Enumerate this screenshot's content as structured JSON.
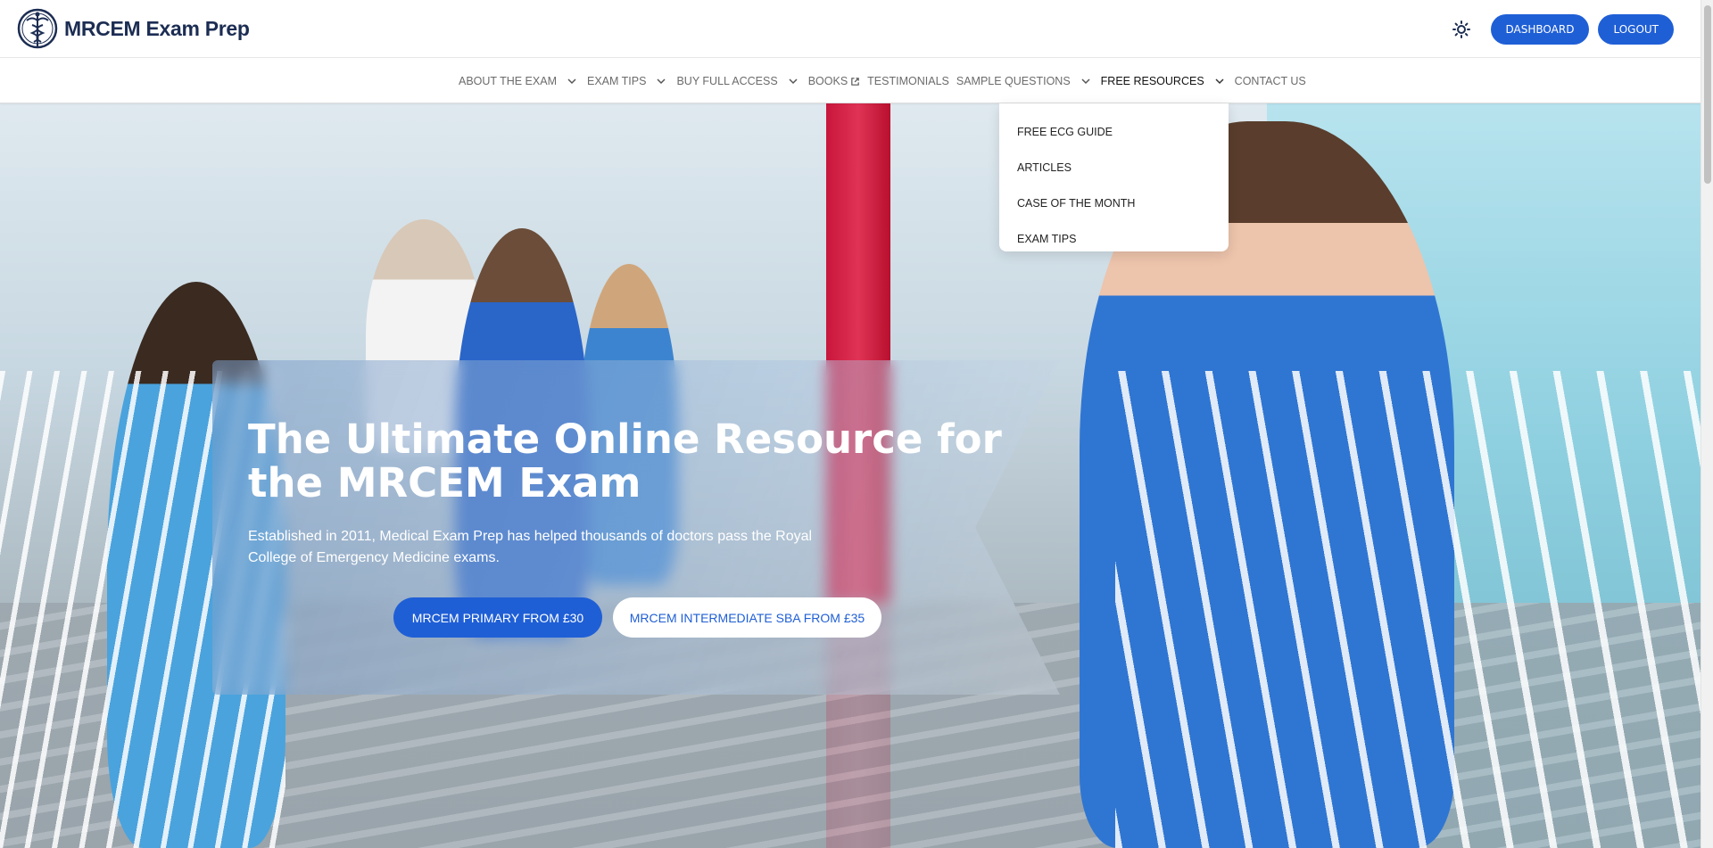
{
  "header": {
    "logo_text": "MRCEM Exam Prep",
    "theme_toggle_icon": "sun-icon",
    "dashboard_label": "DASHBOARD",
    "logout_label": "LOGOUT"
  },
  "nav": {
    "items": [
      {
        "label": "ABOUT THE EXAM",
        "icon": "chevron-down-icon"
      },
      {
        "label": "EXAM TIPS",
        "icon": "chevron-down-icon"
      },
      {
        "label": "BUY FULL ACCESS",
        "icon": "chevron-down-icon"
      },
      {
        "label": "BOOKS",
        "icon": "external-link-icon"
      },
      {
        "label": "TESTIMONIALS"
      },
      {
        "label": "SAMPLE QUESTIONS",
        "icon": "chevron-down-icon"
      },
      {
        "label": "FREE RESOURCES",
        "icon": "chevron-down-icon",
        "active": true
      },
      {
        "label": "CONTACT US"
      }
    ]
  },
  "dropdown": {
    "items": [
      "FREE ECG GUIDE",
      "ARTICLES",
      "CASE OF THE MONTH",
      "EXAM TIPS"
    ]
  },
  "hero": {
    "title": "The Ultimate Online Resource for the MRCEM Exam",
    "subtitle": "Established in 2011, Medical Exam Prep has helped thousands of doctors pass the Royal College of Emergency Medicine exams.",
    "primary_cta": "MRCEM PRIMARY FROM £30",
    "secondary_cta": "MRCEM INTERMEDIATE SBA FROM £35"
  },
  "colors": {
    "brand_blue": "#1f5fd6",
    "logo_navy": "#1c2d53"
  }
}
